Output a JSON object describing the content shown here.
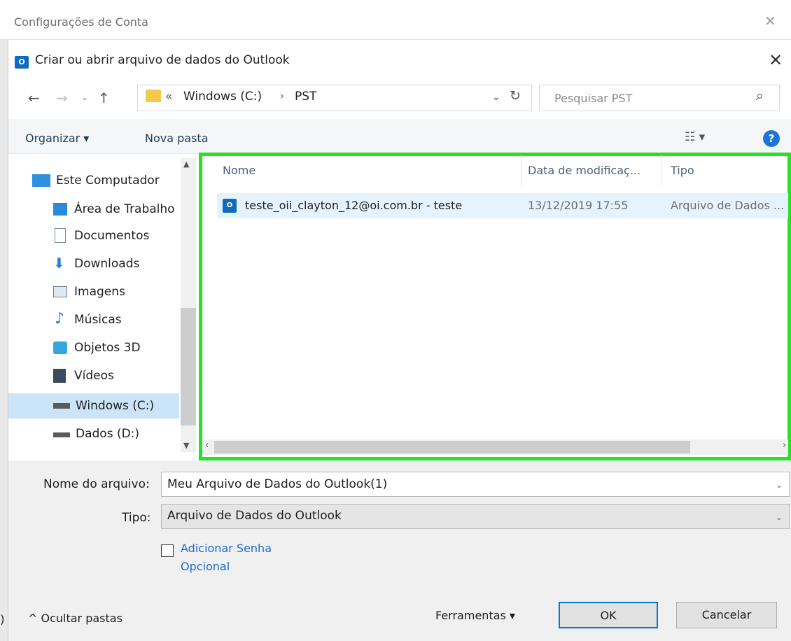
{
  "outer_window": {
    "title": "Configurações de Conta",
    "close": "✕",
    "stray_text": ")"
  },
  "dialog": {
    "app_icon": "O",
    "title": "Criar ou abrir arquivo de dados do Outlook",
    "close": "✕"
  },
  "nav": {
    "back": "←",
    "forward": "→",
    "recent": "⌄",
    "up": "↑",
    "breadcrumb_chevron": "«",
    "breadcrumb": [
      "Windows (C:)",
      "PST"
    ],
    "breadcrumb_separator": "›",
    "address_dropdown": "⌄",
    "refresh": "↻",
    "search_placeholder": "Pesquisar PST",
    "search_icon": "⌕"
  },
  "toolbar": {
    "organize": "Organizar ▾",
    "new_folder": "Nova pasta",
    "view_menu": "☷ ▾",
    "help": "?"
  },
  "sidebar": {
    "items": [
      {
        "label": "Este Computador",
        "icon": "computer-icon"
      },
      {
        "label": "Área de Trabalho",
        "icon": "desktop-icon"
      },
      {
        "label": "Documentos",
        "icon": "document-icon"
      },
      {
        "label": "Downloads",
        "icon": "download-icon"
      },
      {
        "label": "Imagens",
        "icon": "image-icon"
      },
      {
        "label": "Músicas",
        "icon": "music-icon"
      },
      {
        "label": "Objetos 3D",
        "icon": "cube-icon"
      },
      {
        "label": "Vídeos",
        "icon": "video-icon"
      },
      {
        "label": "Windows (C:)",
        "icon": "windows-drive-icon",
        "selected": true
      },
      {
        "label": "Dados (D:)",
        "icon": "drive-icon"
      }
    ],
    "scroll_up": "▲",
    "scroll_down": "▼"
  },
  "filelist": {
    "columns": [
      "Nome",
      "Data de modificaç...",
      "Tipo"
    ],
    "rows": [
      {
        "name": "teste_oii_clayton_12@oi.com.br - teste",
        "modified": "13/12/2019 17:55",
        "type": "Arquivo de Dados ..."
      }
    ],
    "scroll_left": "‹",
    "scroll_right": "›",
    "highlight_color": "#22e422"
  },
  "form": {
    "filename_label": "Nome do arquivo:",
    "filename_value": "Meu Arquivo de Dados do Outlook(1)",
    "filename_dropdown": "⌄",
    "type_label": "Tipo:",
    "type_value": "Arquivo de Dados do Outlook",
    "type_dropdown": "⌄",
    "password_line1": "Adicionar Senha",
    "password_line2": "Opcional"
  },
  "footer": {
    "hide_folders": "^ Ocultar pastas",
    "tools": "Ferramentas ▾",
    "ok": "OK",
    "cancel": "Cancelar"
  }
}
